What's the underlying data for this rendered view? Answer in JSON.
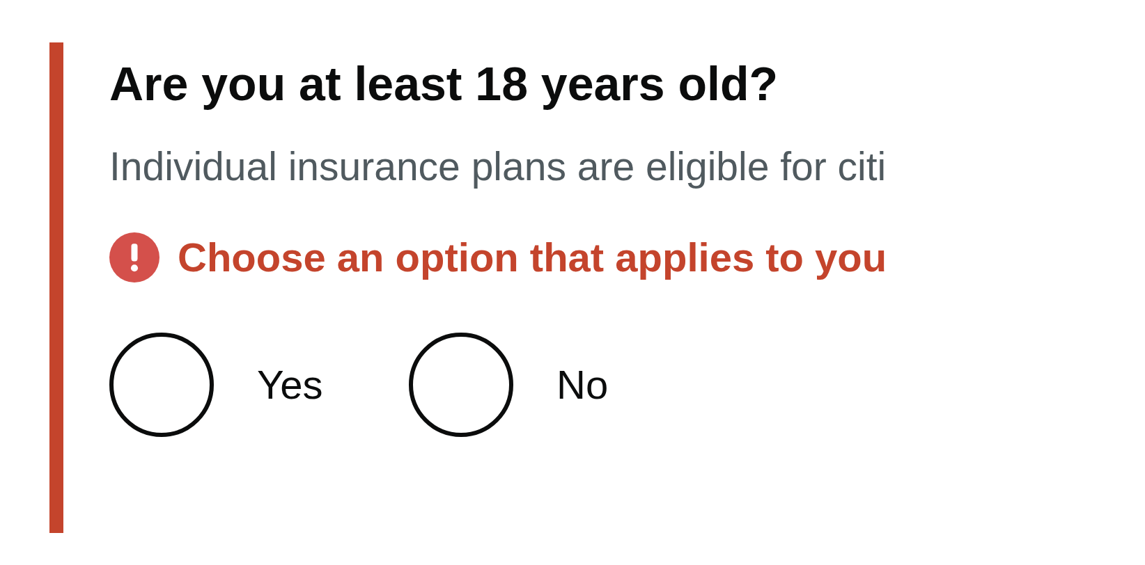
{
  "question": {
    "title": "Are you at least 18 years old?",
    "hint": "Individual insurance plans are eligible for citi",
    "error": "Choose an option that applies to you",
    "options": [
      {
        "label": "Yes",
        "selected": false
      },
      {
        "label": "No",
        "selected": false
      }
    ]
  }
}
